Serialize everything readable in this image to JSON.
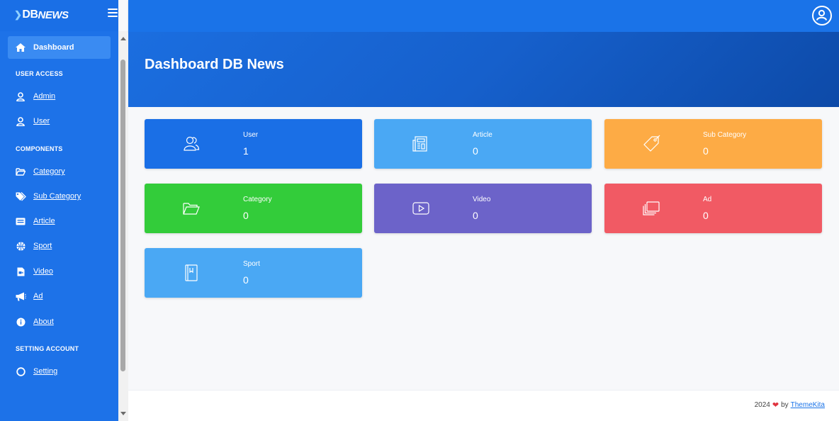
{
  "brand": {
    "logo_db": "DB",
    "logo_news": "NEWS"
  },
  "sidebar": {
    "dashboard": "Dashboard",
    "section_user_access": "USER ACCESS",
    "admin": "Admin",
    "user": "User",
    "section_components": "COMPONENTS",
    "category": "Category",
    "sub_category": "Sub Category",
    "article": "Article",
    "sport": "Sport",
    "video": "Video",
    "ad": "Ad",
    "about": "About",
    "section_setting": "SETTING ACCOUNT",
    "setting": "Setting"
  },
  "header": {
    "title": "Dashboard DB News"
  },
  "cards": [
    {
      "label": "User",
      "value": "1",
      "color": "#1a6fe6",
      "icon": "users-icon"
    },
    {
      "label": "Article",
      "value": "0",
      "color": "#4aa8f4",
      "icon": "newspaper-icon"
    },
    {
      "label": "Sub Category",
      "value": "0",
      "color": "#fdab45",
      "icon": "tag-icon"
    },
    {
      "label": "Category",
      "value": "0",
      "color": "#33cc3a",
      "icon": "folder-icon"
    },
    {
      "label": "Video",
      "value": "0",
      "color": "#6c63c9",
      "icon": "play-icon"
    },
    {
      "label": "Ad",
      "value": "0",
      "color": "#f15a64",
      "icon": "layers-icon"
    },
    {
      "label": "Sport",
      "value": "0",
      "color": "#4aa8f4",
      "icon": "book-icon"
    }
  ],
  "footer": {
    "year": "2024",
    "by": "by",
    "link": "ThemeKita"
  }
}
